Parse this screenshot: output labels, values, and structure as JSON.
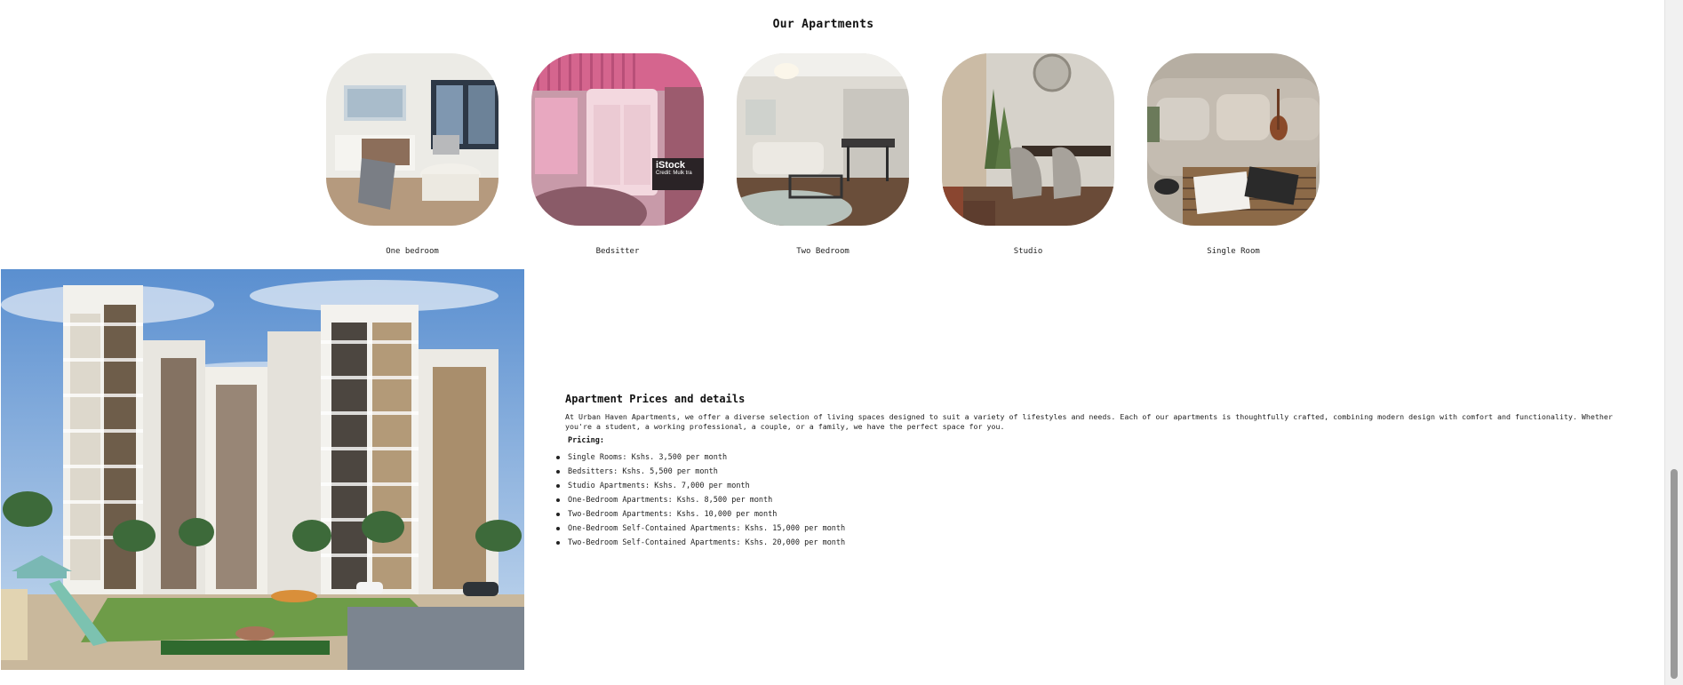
{
  "section": {
    "title": "Our Apartments"
  },
  "apartments": [
    {
      "label": "One bedroom"
    },
    {
      "label": "Bedsitter",
      "watermark": "iStock",
      "watermark_sub": "Credit: Mulk tra"
    },
    {
      "label": "Two Bedroom"
    },
    {
      "label": "Studio"
    },
    {
      "label": "Single Room"
    }
  ],
  "details": {
    "title": "Apartment Prices and details",
    "description": "At Urban Haven Apartments, we offer a diverse selection of living spaces designed to suit a variety of lifestyles and needs. Each of our apartments is thoughtfully crafted, combining modern design with comfort and functionality. Whether you're a student, a working professional, a couple, or a family, we have the perfect space for you.",
    "pricing_label": "Pricing:",
    "prices": [
      "Single Rooms: Kshs. 3,500 per month",
      "Bedsitters: Kshs. 5,500 per month",
      "Studio Apartments: Kshs. 7,000 per month",
      "One-Bedroom Apartments: Kshs. 8,500 per month",
      "Two-Bedroom Apartments: Kshs. 10,000 per month",
      "One-Bedroom Self-Contained Apartments: Kshs. 15,000 per month",
      "Two-Bedroom Self-Contained Apartments: Kshs. 20,000 per month"
    ]
  }
}
